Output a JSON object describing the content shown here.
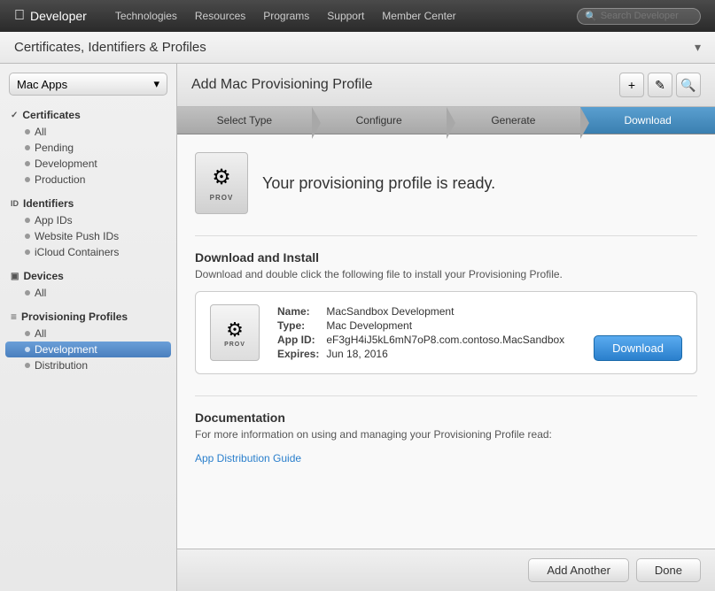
{
  "app": {
    "apple_symbol": "&#63743;",
    "brand": "Developer"
  },
  "nav": {
    "links": [
      {
        "label": "Technologies",
        "id": "technologies"
      },
      {
        "label": "Resources",
        "id": "resources"
      },
      {
        "label": "Programs",
        "id": "programs"
      },
      {
        "label": "Support",
        "id": "support"
      },
      {
        "label": "Member Center",
        "id": "member-center"
      }
    ],
    "search_placeholder": "Search Developer"
  },
  "sub_header": {
    "title": "Certificates, Identifiers & Profiles",
    "arrow": "▾"
  },
  "sidebar": {
    "dropdown_label": "Mac Apps",
    "sections": [
      {
        "id": "certificates",
        "label": "Certificates",
        "icon": "✓",
        "items": [
          {
            "label": "All",
            "active": false
          },
          {
            "label": "Pending",
            "active": false
          },
          {
            "label": "Development",
            "active": false
          },
          {
            "label": "Production",
            "active": false
          }
        ]
      },
      {
        "id": "identifiers",
        "label": "Identifiers",
        "icon": "ID",
        "items": [
          {
            "label": "App IDs",
            "active": false
          },
          {
            "label": "Website Push IDs",
            "active": false
          },
          {
            "label": "iCloud Containers",
            "active": false
          }
        ]
      },
      {
        "id": "devices",
        "label": "Devices",
        "icon": "□",
        "items": [
          {
            "label": "All",
            "active": false
          }
        ]
      },
      {
        "id": "provisioning-profiles",
        "label": "Provisioning Profiles",
        "icon": "☰",
        "items": [
          {
            "label": "All",
            "active": false
          },
          {
            "label": "Development",
            "active": true
          },
          {
            "label": "Distribution",
            "active": false
          }
        ]
      }
    ]
  },
  "content": {
    "title": "Add Mac Provisioning Profile",
    "header_buttons": [
      {
        "icon": "+",
        "name": "add-button"
      },
      {
        "icon": "✎",
        "name": "edit-button"
      },
      {
        "icon": "⌕",
        "name": "search-button"
      }
    ],
    "wizard": {
      "steps": [
        {
          "label": "Select Type",
          "state": "completed"
        },
        {
          "label": "Configure",
          "state": "completed"
        },
        {
          "label": "Generate",
          "state": "completed"
        },
        {
          "label": "Download",
          "state": "active"
        }
      ]
    },
    "ready": {
      "icon_label": "PROV",
      "message": "Your provisioning profile is ready."
    },
    "download_install": {
      "title": "Download and Install",
      "description": "Download and double click the following file to install your Provisioning Profile.",
      "profile": {
        "name_label": "Name:",
        "name_value": "MacSandbox Development",
        "type_label": "Type:",
        "type_value": "Mac Development",
        "app_id_label": "App ID:",
        "app_id_value": "eF3gH4iJ5kL6mN7oP8.com.contoso.MacSandbox",
        "expires_label": "Expires:",
        "expires_value": "Jun 18, 2016",
        "icon_label": "PROV"
      },
      "download_button": "Download"
    },
    "documentation": {
      "title": "Documentation",
      "description": "For more information on using and managing your Provisioning Profile read:",
      "link_text": "App Distribution Guide",
      "link_href": "#"
    },
    "footer": {
      "add_another": "Add Another",
      "done": "Done"
    }
  }
}
